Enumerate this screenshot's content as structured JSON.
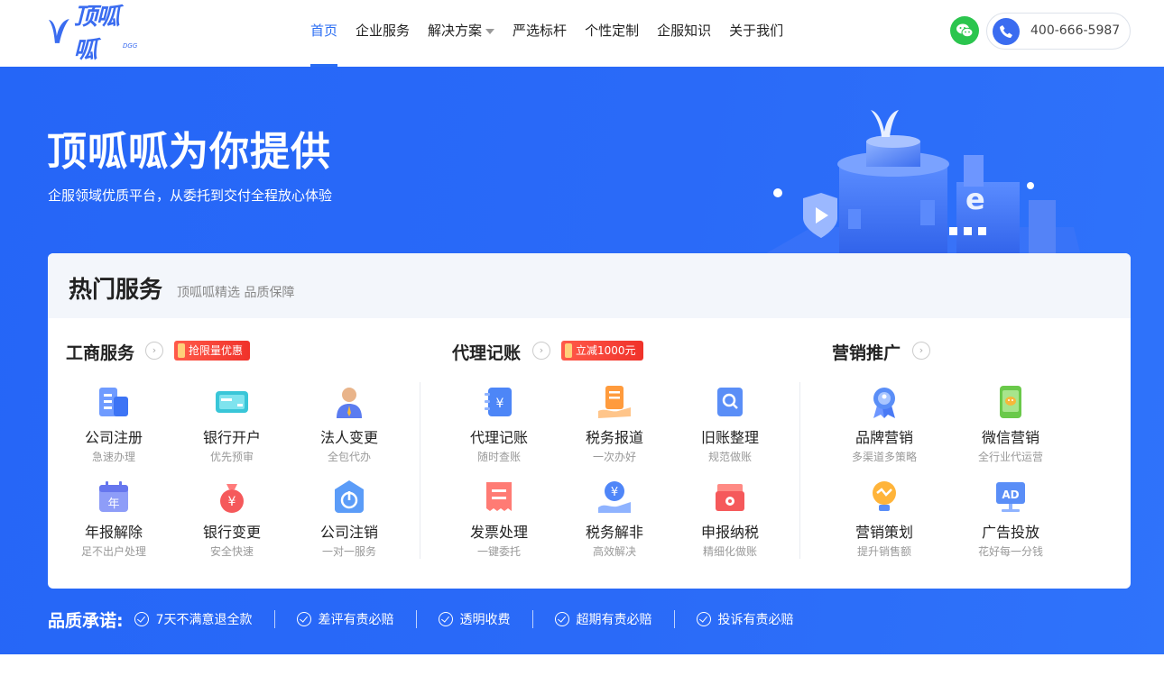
{
  "header": {
    "logo_text": "顶呱呱",
    "logo_sub": "DGG",
    "nav": [
      {
        "label": "首页",
        "active": true
      },
      {
        "label": "企业服务"
      },
      {
        "label": "解决方案",
        "has_dropdown": true
      },
      {
        "label": "严选标杆"
      },
      {
        "label": "个性定制"
      },
      {
        "label": "企服知识"
      },
      {
        "label": "关于我们"
      }
    ],
    "phone": "400-666-5987",
    "wechat_icon": "wechat-icon",
    "phone_icon": "phone-icon"
  },
  "hero": {
    "title": "顶呱呱为你提供",
    "subtitle": "企服领域优质平台，从委托到交付全程放心体验"
  },
  "services": {
    "title": "热门服务",
    "subtitle": "顶呱呱精选 品质保障",
    "groups": [
      {
        "title": "工商服务",
        "badge": "抢限量优惠",
        "items": [
          {
            "label": "公司注册",
            "desc": "急速办理",
            "icon": "building-icon"
          },
          {
            "label": "银行开户",
            "desc": "优先预审",
            "icon": "bank-card-icon"
          },
          {
            "label": "法人变更",
            "desc": "全包代办",
            "icon": "person-icon"
          },
          {
            "label": "年报解除",
            "desc": "足不出户处理",
            "icon": "calendar-icon"
          },
          {
            "label": "银行变更",
            "desc": "安全快速",
            "icon": "money-bag-icon"
          },
          {
            "label": "公司注销",
            "desc": "一对一服务",
            "icon": "power-icon"
          }
        ]
      },
      {
        "title": "代理记账",
        "badge": "立减1000元",
        "items": [
          {
            "label": "代理记账",
            "desc": "随时查账",
            "icon": "ledger-icon"
          },
          {
            "label": "税务报道",
            "desc": "一次办好",
            "icon": "tax-doc-icon"
          },
          {
            "label": "旧账整理",
            "desc": "规范做账",
            "icon": "search-book-icon"
          },
          {
            "label": "发票处理",
            "desc": "一键委托",
            "icon": "invoice-icon"
          },
          {
            "label": "税务解非",
            "desc": "高效解决",
            "icon": "coin-hand-icon"
          },
          {
            "label": "申报纳税",
            "desc": "精细化做账",
            "icon": "tax-box-icon"
          }
        ]
      },
      {
        "title": "营销推广",
        "badge": "",
        "items": [
          {
            "label": "品牌营销",
            "desc": "多渠道多策略",
            "icon": "medal-icon"
          },
          {
            "label": "微信营销",
            "desc": "全行业代运营",
            "icon": "wechat-phone-icon"
          },
          {
            "label": "营销策划",
            "desc": "提升销售额",
            "icon": "bulb-icon"
          },
          {
            "label": "广告投放",
            "desc": "花好每一分钱",
            "icon": "ad-monitor-icon"
          }
        ]
      }
    ]
  },
  "quality": {
    "title": "品质承诺:",
    "items": [
      "7天不满意退全款",
      "差评有责必赔",
      "透明收费",
      "超期有责必赔",
      "投诉有责必赔"
    ]
  },
  "colors": {
    "brand_blue": "#2b6ef3",
    "hero_bg": "#2868f7",
    "badge_red": "#f0322a",
    "wechat_green": "#2bc54e"
  }
}
